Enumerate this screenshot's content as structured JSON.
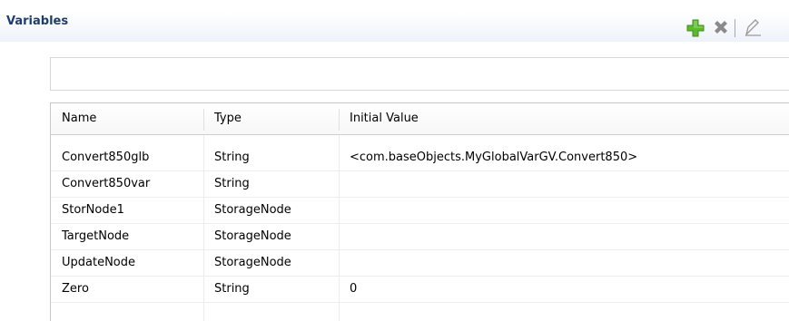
{
  "panel": {
    "title": "Variables"
  },
  "toolbar": {
    "add_icon": "plus-icon",
    "delete_icon": "delete-x-icon",
    "edit_icon": "edit-icon",
    "accent_green": "#5cb82e",
    "icon_gray": "#8a8a8a"
  },
  "filter": {
    "value": ""
  },
  "table": {
    "columns": [
      "Name",
      "Type",
      "Initial Value"
    ],
    "rows": [
      {
        "name": "Convert850glb",
        "type": "String",
        "initial_value": "<com.baseObjects.MyGlobalVarGV.Convert850>"
      },
      {
        "name": "Convert850var",
        "type": "String",
        "initial_value": ""
      },
      {
        "name": "StorNode1",
        "type": "StorageNode",
        "initial_value": ""
      },
      {
        "name": "TargetNode",
        "type": "StorageNode",
        "initial_value": ""
      },
      {
        "name": "UpdateNode",
        "type": "StorageNode",
        "initial_value": ""
      },
      {
        "name": "Zero",
        "type": "String",
        "initial_value": "0"
      }
    ]
  }
}
